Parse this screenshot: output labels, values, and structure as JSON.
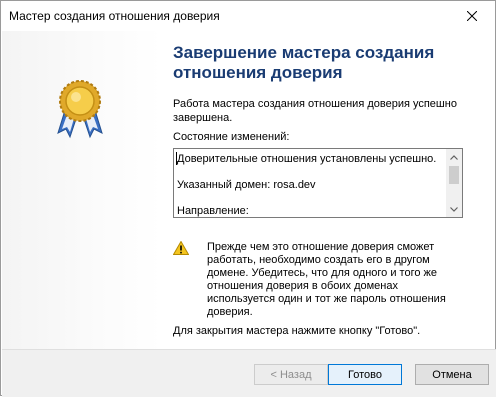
{
  "window": {
    "title": "Мастер создания отношения доверия"
  },
  "heading": "Завершение мастера создания отношения доверия",
  "intro": "Работа мастера создания отношения доверия успешно завершена.",
  "changes": {
    "label": "Состояние изменений:",
    "lines": [
      "Доверительные отношения установлены успешно.",
      "Указанный домен: rosa.dev",
      "Направление:"
    ]
  },
  "warning": "Прежде чем это отношение доверия сможет работать, необходимо создать его в другом домене. Убедитесь, что для одного и того же отношения доверия в обоих доменах используется один и тот же пароль отношения доверия.",
  "finish_hint": "Для закрытия мастера нажмите кнопку \"Готово\".",
  "buttons": {
    "back": "< Назад",
    "finish": "Готово",
    "cancel": "Отмена"
  },
  "icons": {
    "close": "close-icon",
    "medal": "award-ribbon-icon",
    "warning": "warning-triangle-icon"
  },
  "colors": {
    "heading": "#1a3c73",
    "footer": "#f0f0f0",
    "default_button_border": "#0078d7"
  }
}
